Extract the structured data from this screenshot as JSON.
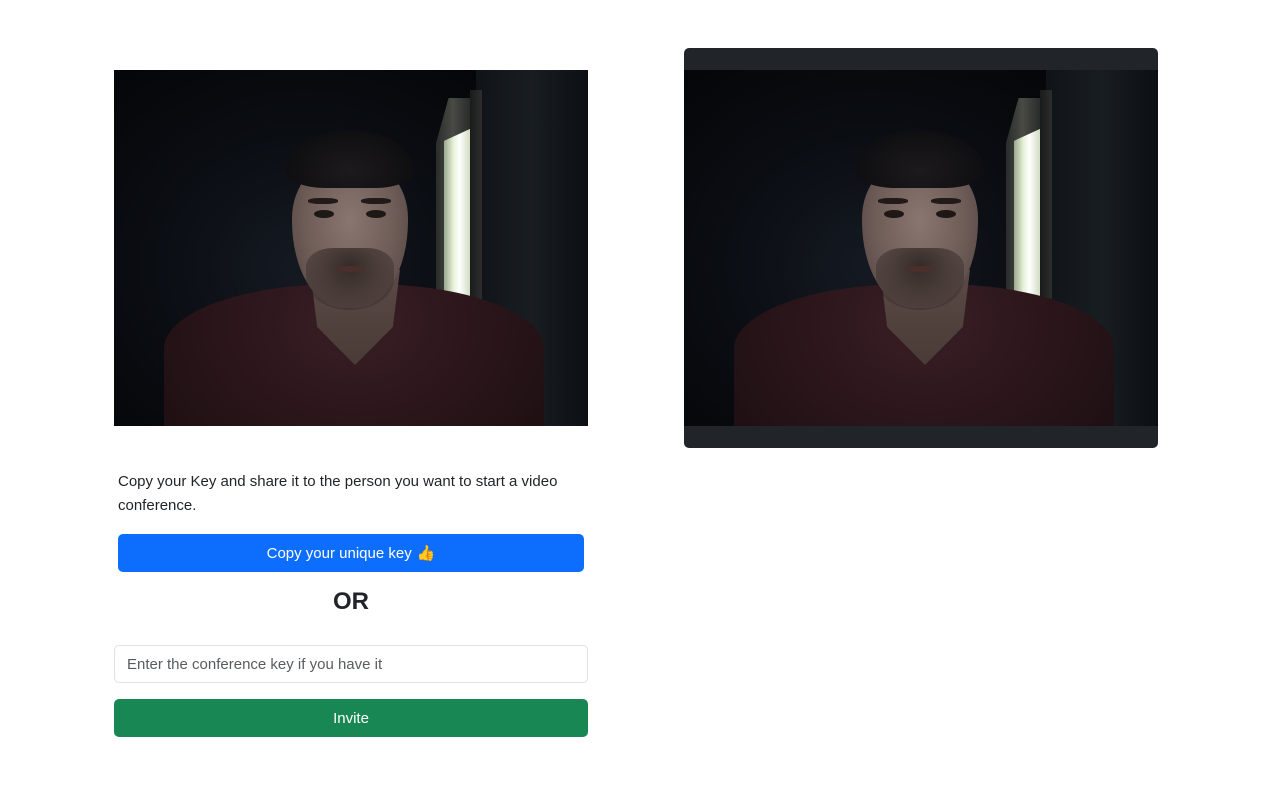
{
  "local_video": {
    "label": "local-webcam-feed"
  },
  "remote_video": {
    "label": "remote-webcam-feed"
  },
  "instructions": {
    "text": "Copy your Key and share it to the person you want to start a video conference."
  },
  "copy_key_button": {
    "label": "Copy your unique key",
    "icon": "thumbs-up-icon",
    "icon_glyph": "👍",
    "color": "#0d6efd"
  },
  "divider": {
    "text": "OR"
  },
  "conference_key_input": {
    "value": "",
    "placeholder": "Enter the conference key if you have it"
  },
  "invite_button": {
    "label": "Invite",
    "color": "#198754"
  }
}
